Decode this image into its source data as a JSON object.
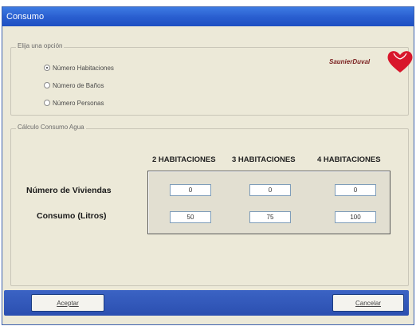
{
  "window": {
    "title": "Consumo"
  },
  "options_group": {
    "label": "Elija una opción",
    "options": [
      {
        "label": "Número Habitaciones",
        "selected": true
      },
      {
        "label": "Número de Baños",
        "selected": false
      },
      {
        "label": "Número Personas",
        "selected": false
      }
    ]
  },
  "brand": {
    "name": "SaunierDuval"
  },
  "calc_group": {
    "label": "Cálculo Consumo Agua",
    "columns": [
      "2 HABITACIONES",
      "3 HABITACIONES",
      "4 HABITACIONES"
    ],
    "rows": [
      {
        "label": "Número de Viviendas",
        "values": [
          "0",
          "0",
          "0"
        ]
      },
      {
        "label": "Consumo (Litros)",
        "values": [
          "50",
          "75",
          "100"
        ]
      }
    ]
  },
  "buttons": {
    "accept": "Aceptar",
    "cancel": "Cancelar"
  },
  "colors": {
    "titlebar": "#2a5fd0",
    "logo_red": "#d8162b",
    "panel": "#ece9d8"
  }
}
